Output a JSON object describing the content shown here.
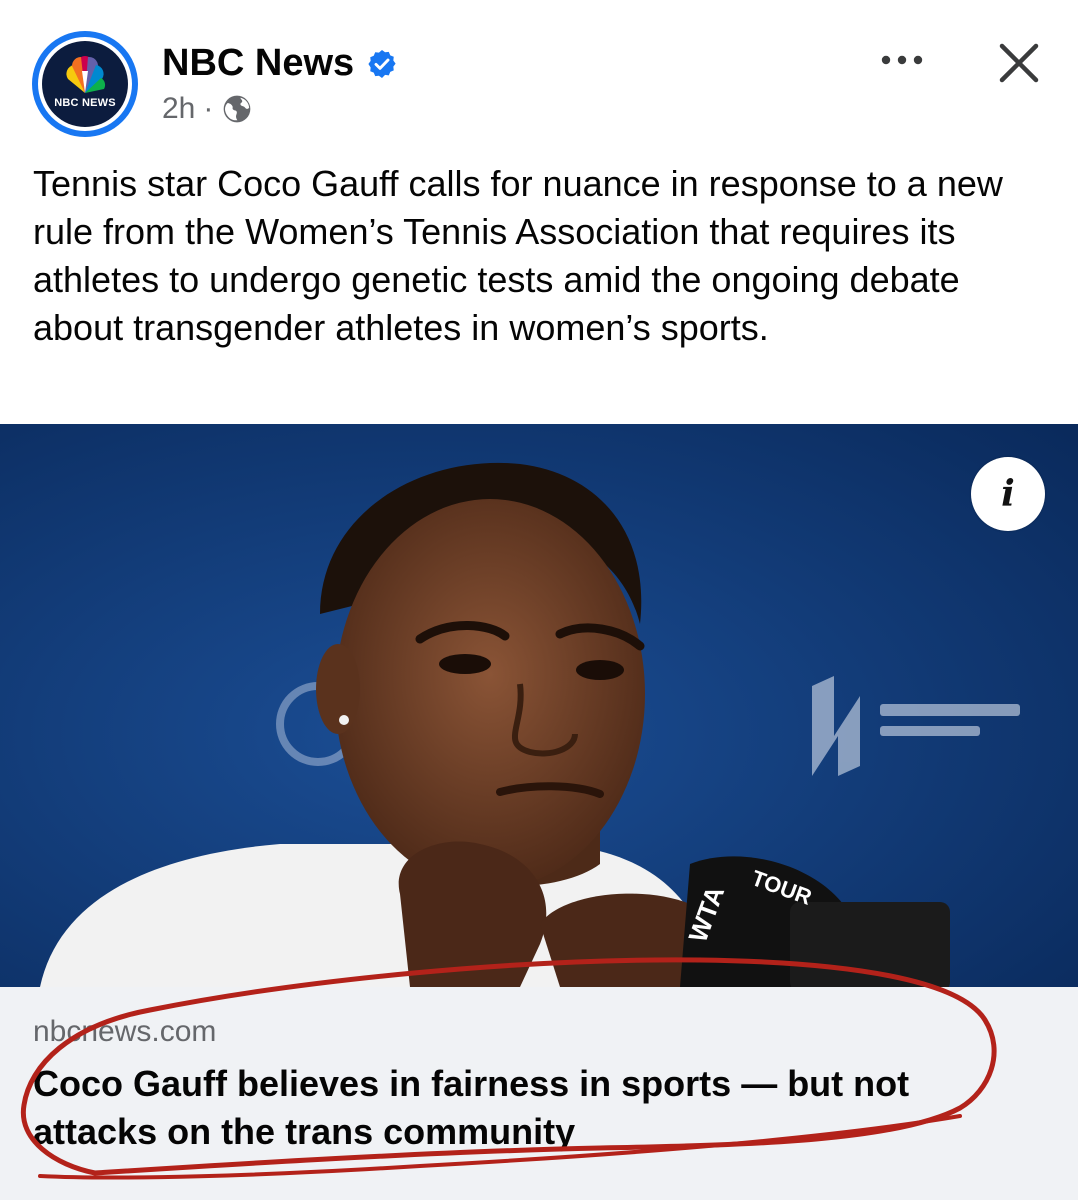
{
  "post": {
    "page_name": "NBC News",
    "avatar_logo_text": "NBC NEWS",
    "time": "2h",
    "separator": "·",
    "caption": "Tennis star Coco Gauff calls for nuance in response to a new rule from the Women’s Tennis Association that requires its athletes to undergo genetic tests amid the ongoing debate about transgender athletes in women’s sports."
  },
  "icons": {
    "verified": "verified-badge-icon",
    "audience": "globe-icon",
    "more": "more-horizontal-icon",
    "close": "close-icon",
    "info": "info-icon"
  },
  "photo": {
    "info_label": "i"
  },
  "link": {
    "domain": "nbcnews.com",
    "headline": "Coco Gauff believes in fairness in sports — but not attacks on the trans community"
  },
  "colors": {
    "verified_blue": "#1877f2",
    "annotation_red": "#b3221a",
    "link_background": "#f0f2f5"
  }
}
